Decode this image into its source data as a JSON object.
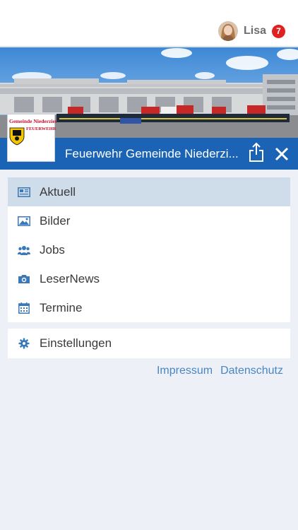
{
  "user": {
    "name": "Lisa",
    "notification_count": "7"
  },
  "header": {
    "title": "Feuerwehr Gemeinde Niederzi..."
  },
  "logo": {
    "text_top": "Gemeinde Niederzier",
    "text_sub": "FEUERWEHR"
  },
  "menu": {
    "items": [
      {
        "label": "Aktuell",
        "icon": "newspaper-icon",
        "active": true
      },
      {
        "label": "Bilder",
        "icon": "image-icon"
      },
      {
        "label": "Jobs",
        "icon": "people-icon"
      },
      {
        "label": "LeserNews",
        "icon": "camera-icon"
      },
      {
        "label": "Termine",
        "icon": "calendar-icon"
      }
    ]
  },
  "settings": {
    "label": "Einstellungen",
    "icon": "gear-icon"
  },
  "footer": {
    "impressum": "Impressum",
    "datenschutz": "Datenschutz"
  },
  "colors": {
    "primary": "#1b64b5",
    "icon": "#3a78b8",
    "active_bg": "#cfdcea",
    "badge": "#e02121",
    "link": "#4a86c0"
  }
}
